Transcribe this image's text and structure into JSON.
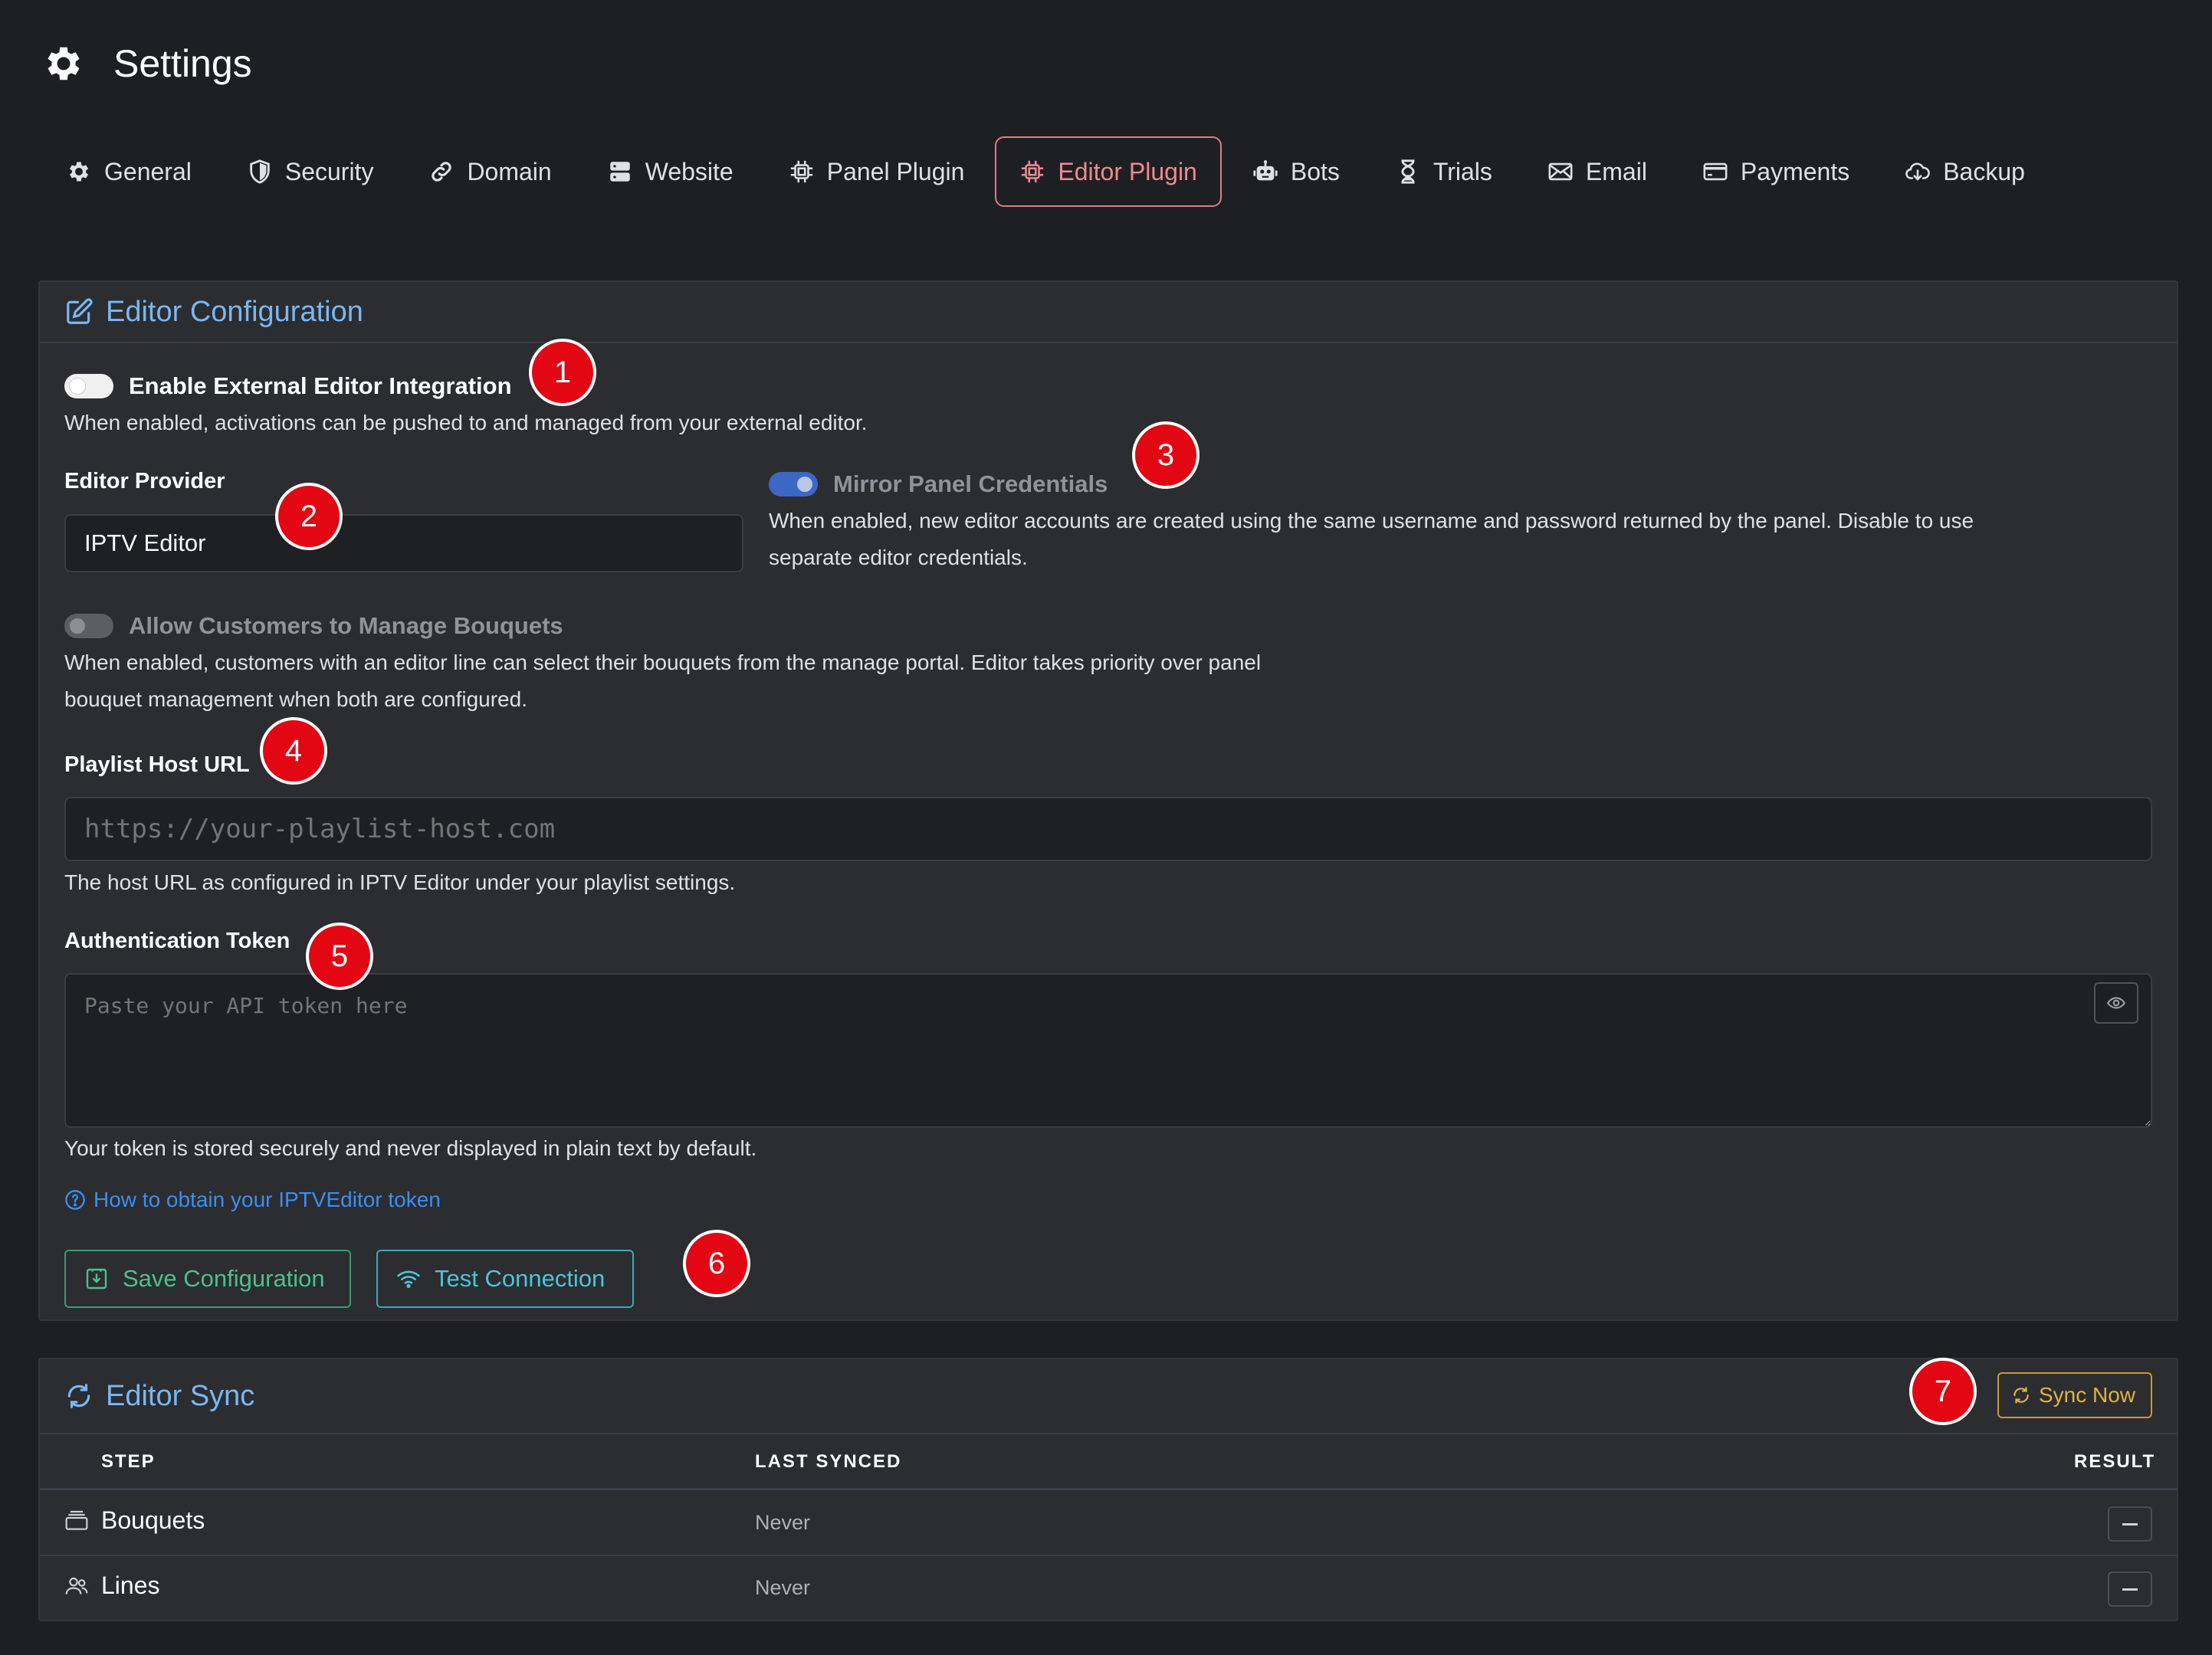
{
  "page": {
    "title": "Settings",
    "icon": "gear-icon"
  },
  "nav": {
    "tabs": [
      {
        "label": "General",
        "icon": "gear-icon"
      },
      {
        "label": "Security",
        "icon": "shield-icon"
      },
      {
        "label": "Domain",
        "icon": "link-icon"
      },
      {
        "label": "Website",
        "icon": "server-icon"
      },
      {
        "label": "Panel Plugin",
        "icon": "cpu-icon"
      },
      {
        "label": "Editor Plugin",
        "icon": "cpu-icon",
        "active": true
      },
      {
        "label": "Bots",
        "icon": "robot-icon"
      },
      {
        "label": "Trials",
        "icon": "hourglass-icon"
      },
      {
        "label": "Email",
        "icon": "envelope-icon"
      },
      {
        "label": "Payments",
        "icon": "credit-card-icon"
      },
      {
        "label": "Backup",
        "icon": "cloud-download-icon"
      }
    ]
  },
  "editor_config": {
    "title": "Editor Configuration",
    "enable_integration": {
      "label": "Enable External Editor Integration",
      "enabled": false,
      "help": "When enabled, activations can be pushed to and managed from your external editor."
    },
    "provider": {
      "label": "Editor Provider",
      "value": "IPTV Editor"
    },
    "mirror_credentials": {
      "label": "Mirror Panel Credentials",
      "enabled": true,
      "help_line1": "When enabled, new editor accounts are created using the same username and password returned by the panel. Disable to use",
      "help_line2": "separate editor credentials."
    },
    "manage_bouquets": {
      "label": "Allow Customers to Manage Bouquets",
      "enabled": false,
      "help_line1": "When enabled, customers with an editor line can select their bouquets from the manage portal. Editor takes priority over panel",
      "help_line2": "bouquet management when both are configured."
    },
    "playlist_host": {
      "label": "Playlist Host URL",
      "placeholder": "https://your-playlist-host.com",
      "help": "The host URL as configured in IPTV Editor under your playlist settings."
    },
    "auth_token": {
      "label": "Authentication Token",
      "placeholder": "Paste your API token here",
      "help": "Your token is stored securely and never displayed in plain text by default."
    },
    "help_link": "How to obtain your IPTVEditor token",
    "save_button": "Save Configuration",
    "test_button": "Test Connection"
  },
  "editor_sync": {
    "title": "Editor Sync",
    "sync_button": "Sync Now",
    "columns": [
      "STEP",
      "LAST SYNCED",
      "RESULT"
    ],
    "rows": [
      {
        "step": "Bouquets",
        "icon": "layers-icon",
        "last_synced": "Never",
        "result": "—"
      },
      {
        "step": "Lines",
        "icon": "users-icon",
        "last_synced": "Never",
        "result": "—"
      }
    ]
  },
  "annotations": [
    "1",
    "2",
    "3",
    "4",
    "5",
    "6",
    "7"
  ],
  "colors": {
    "background": "#1e1f23",
    "card": "#2b2d31",
    "accent_blue": "#79b8f2",
    "active_tab": "#e07c84",
    "save_green": "#4fbf8a",
    "test_cyan": "#4fc3d8",
    "sync_yellow": "#e0b341",
    "badge_red": "#e30613"
  }
}
